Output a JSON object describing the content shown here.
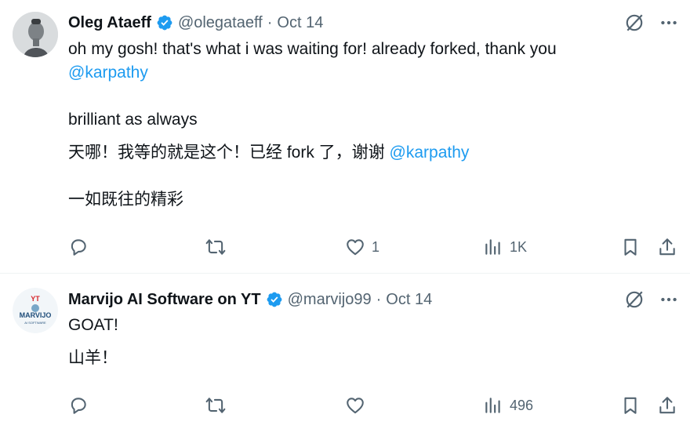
{
  "tweets": [
    {
      "author_name": "Oleg Ataeff",
      "handle": "@olegataeff",
      "separator": "·",
      "date": "Oct 14",
      "line1": "oh my gosh! that's what i was waiting for! already forked, thank you",
      "line2_mention": "@karpathy",
      "line3": "brilliant as always",
      "line4_text": "天哪！我等的就是这个！已经 fork 了，谢谢",
      "line4_mention": "@karpathy",
      "line5": "一如既往的精彩",
      "likes": "1",
      "views": "1K",
      "avatar_icon": "person-photo-icon"
    },
    {
      "author_name": "Marvijo AI Software on YT",
      "handle": "@marvijo99",
      "separator": "·",
      "date": "Oct 14",
      "line1": "GOAT!",
      "line2": "山羊！",
      "likes": "",
      "views": "496",
      "avatar_logo": {
        "top": "YT",
        "middle": "MARVIJO",
        "bottom": "AI SOFTWARE"
      }
    }
  ],
  "colors": {
    "text": "#0f1419",
    "secondary": "#536471",
    "accent": "#1d9bf0",
    "divider": "#eff3f4"
  },
  "icons": [
    "verified-badge-icon",
    "grok-icon",
    "more-icon",
    "reply-icon",
    "retweet-icon",
    "like-icon",
    "views-icon",
    "bookmark-icon",
    "share-icon"
  ]
}
